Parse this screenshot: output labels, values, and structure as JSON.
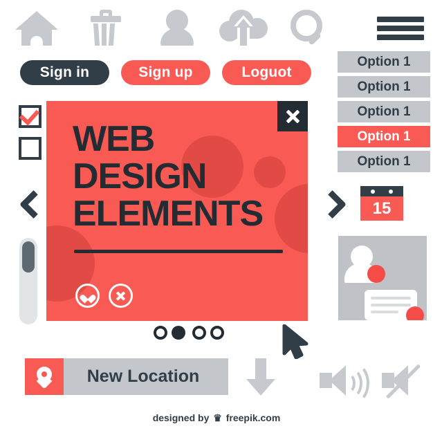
{
  "toolbar_icons": [
    {
      "name": "home-icon",
      "label": "Home"
    },
    {
      "name": "trash-icon",
      "label": "Trash"
    },
    {
      "name": "user-icon",
      "label": "User"
    },
    {
      "name": "cloud-upload-icon",
      "label": "Cloud upload"
    },
    {
      "name": "search-icon",
      "label": "Search"
    },
    {
      "name": "hamburger-menu-icon",
      "label": "Menu"
    }
  ],
  "buttons": {
    "sign_in": "Sign in",
    "sign_up": "Sign up",
    "logout": "Loguot"
  },
  "options": [
    {
      "label": "Option 1",
      "selected": false
    },
    {
      "label": "Option 1",
      "selected": false
    },
    {
      "label": "Option 1",
      "selected": false
    },
    {
      "label": "Option 1",
      "selected": true
    },
    {
      "label": "Option 1",
      "selected": false
    }
  ],
  "checkboxes": [
    {
      "checked": true
    },
    {
      "checked": false
    }
  ],
  "banner": {
    "title": "WEB\nDESIGN\nELEMENTS",
    "close_label": "×",
    "favorite_icon": "heart-icon",
    "dismiss_icon": "close-circle-icon"
  },
  "carousel": {
    "prev_icon": "chevron-left-icon",
    "next_icon": "chevron-right-icon",
    "dots": [
      false,
      true,
      false,
      false
    ]
  },
  "calendar": {
    "day": "15"
  },
  "chat_panel": {
    "avatar_icon": "avatar-icon",
    "bubble_icon": "speech-bubble-icon",
    "badge_count": ""
  },
  "location_bar": {
    "pin_icon": "map-pin-icon",
    "label": "New Location"
  },
  "bottom_icons": [
    {
      "name": "download-arrow-icon",
      "label": "Download"
    },
    {
      "name": "cursor-arrow-icon",
      "label": "Cursor"
    },
    {
      "name": "speaker-on-icon",
      "label": "Sound on"
    },
    {
      "name": "speaker-mute-icon",
      "label": "Sound muted"
    }
  ],
  "footer": {
    "prefix": "designed by",
    "crown": "♛",
    "brand": "freepik.com"
  },
  "colors": {
    "red": "#fa5a54",
    "red_dark": "#e24a46",
    "dark": "#313d47",
    "dark_ink": "#242c33",
    "grey": "#c3c7cb",
    "grey_icon": "#c6cace",
    "white": "#ffffff"
  }
}
